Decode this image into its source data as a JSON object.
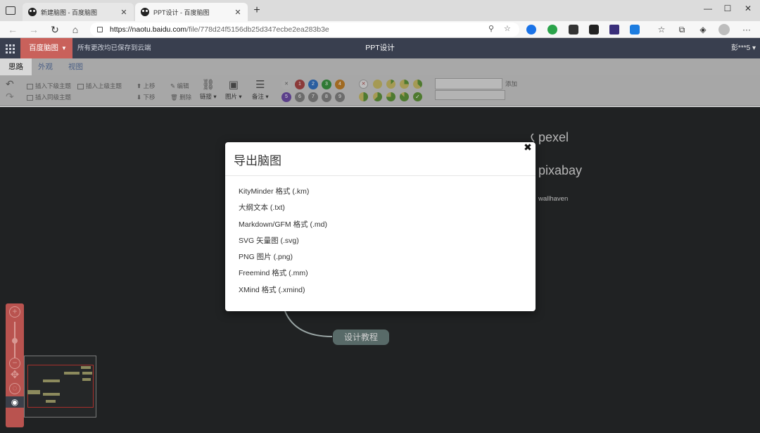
{
  "browser": {
    "tabs": [
      {
        "title": "新建脑图 - 百度脑图",
        "active": false
      },
      {
        "title": "PPT设计 - 百度脑图",
        "active": true
      }
    ],
    "url_host": "https://naotu.baidu.com",
    "url_path": "/file/778d24f5156db25d347ecbe2ea283b3e",
    "window_buttons": [
      "—",
      "☐",
      "✕"
    ]
  },
  "app": {
    "brand": "百度脑图",
    "save_status": "所有更改均已保存到云端",
    "doc_title": "PPT设计",
    "user": "彭***5"
  },
  "menu_tabs": [
    "思路",
    "外观",
    "视图"
  ],
  "toolbar": {
    "insert_child": "插入下级主题",
    "insert_parent": "插入上级主题",
    "insert_sibling": "插入同级主题",
    "move_up": "上移",
    "move_down": "下移",
    "edit": "编辑",
    "delete": "删除",
    "link": "链接",
    "image": "图片",
    "note": "备注",
    "priority_labels": [
      "1",
      "2",
      "3",
      "4",
      "5",
      "6",
      "7",
      "8",
      "9"
    ],
    "resource_add": "添加"
  },
  "canvas": {
    "nodes": [
      "pexel",
      "pixabay",
      "wallhaven",
      "设计教程"
    ]
  },
  "modal": {
    "title": "导出脑图",
    "close": "✖",
    "options": [
      "KityMinder 格式 (.km)",
      "大纲文本 (.txt)",
      "Markdown/GFM 格式 (.md)",
      "SVG 矢量图 (.svg)",
      "PNG 图片 (.png)",
      "Freemind 格式 (.mm)",
      "XMind 格式 (.xmind)"
    ]
  },
  "colors": {
    "app_header": "#393f4f",
    "brand": "#c9615b",
    "canvas": "#202223",
    "node": "#586a68"
  }
}
